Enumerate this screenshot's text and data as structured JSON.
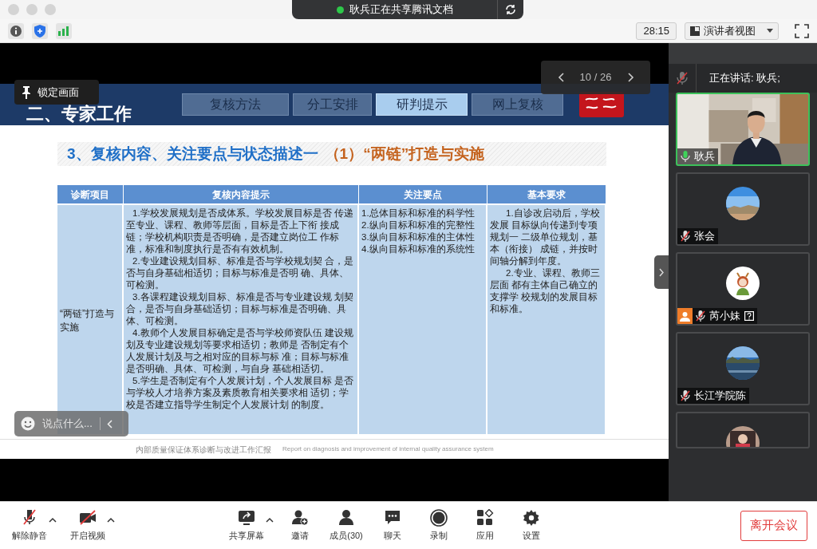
{
  "share_banner": {
    "text": "耿兵正在共享腾讯文档"
  },
  "toolbar": {
    "timer": "28:15",
    "view_menu": "演讲者视图"
  },
  "slide": {
    "section_title": "二、专家工作",
    "tabs": [
      {
        "label": "复核方法",
        "selected": false
      },
      {
        "label": "分工安排",
        "selected": false
      },
      {
        "label": "研判提示",
        "selected": true
      },
      {
        "label": "网上复核",
        "selected": false
      }
    ],
    "heading": "3、复核内容、关注要点与状态描述一",
    "heading_sub": "（1）“两链”打造与实施",
    "table": {
      "columns": [
        "诊断项目",
        "复核内容提示",
        "关注要点",
        "基本要求"
      ],
      "rows": [
        {
          "item": "“两链”打造与实施",
          "content": [
            "1.学校发展规划是否成体系。学校发展目标是否 传递至专业、课程、教师等层面，目标是否上下衔 接成链；学校机构职责是否明确，是否建立岗位工 作标准，标准和制度执行是否有有效机制。",
            "2.专业建设规划目标、标准是否与学校规划契 合，是否与自身基础相适切；目标与标准是否明 确、具体、可检测。",
            "3.各课程建设规划目标、标准是否与专业建设规 划契合，是否与自身基础适切；目标与标准是否明确、具体、可检测。",
            "4.教师个人发展目标确定是否与学校师资队伍 建设规划及专业建设规划等要求相适切；教师是 否制定有个人发展计划及与之相对应的目标与标 准；目标与标准是否明确、具体、可检测，与自身 基础相适切。",
            "5.学生是否制定有个人发展计划，个人发展目标 是否与学校人才培养方案及素质教育相关要求相 适切；学校是否建立指导学生制定个人发展计划 的制度。"
          ],
          "focus": [
            "1.总体目标和标准的科学性",
            "2.纵向目标和标准的完整性",
            "3.纵向目标和标准的主体性",
            "4.纵向目标和标准的系统性"
          ],
          "requirements": [
            "1.自诊改启动后，学校发展 目标纵向传递到专项规划一 二级单位规划，基本（衔接） 成链，并按时间轴分解到年度。",
            "2.专业、课程、教师三层面 都有主体自己确立的支撑学 校规划的发展目标和标准。"
          ]
        }
      ]
    },
    "footer_cn": "内部质量保证体系诊断与改进工作汇报",
    "footer_en": "Report on diagnosis and improvement of internal quality assurance system"
  },
  "page_counter": "10 / 26",
  "lock_tooltip": "锁定画面",
  "chat_input": {
    "placeholder": "说点什么..."
  },
  "speaking": {
    "text": "正在讲话: 耿兵;"
  },
  "participants": [
    {
      "kind": "video",
      "name": "耿兵",
      "muted": false,
      "speaking": true,
      "person_badge": false,
      "question_mark": false
    },
    {
      "kind": "avatar",
      "name": "张会",
      "muted": true,
      "speaking": false,
      "person_badge": false,
      "question_mark": false
    },
    {
      "kind": "avatar",
      "name": "芮小妹",
      "muted": true,
      "speaking": false,
      "person_badge": true,
      "question_mark": true
    },
    {
      "kind": "avatar",
      "name": "长江学院陈",
      "muted": true,
      "speaking": false,
      "person_badge": false,
      "question_mark": false
    },
    {
      "kind": "avatar",
      "speaking": false
    }
  ],
  "bottom_bar": {
    "items": [
      {
        "label": "解除静音",
        "has_menu": true
      },
      {
        "label": "开启视频",
        "has_menu": true
      },
      {
        "label": "共享屏幕",
        "has_menu": true
      },
      {
        "label": "邀请",
        "has_menu": false
      },
      {
        "label": "成员(30)",
        "has_menu": false
      },
      {
        "label": "聊天",
        "has_menu": false
      },
      {
        "label": "录制",
        "has_menu": false
      },
      {
        "label": "应用",
        "has_menu": false
      },
      {
        "label": "设置",
        "has_menu": false
      }
    ],
    "leave_button": "离开会议"
  }
}
